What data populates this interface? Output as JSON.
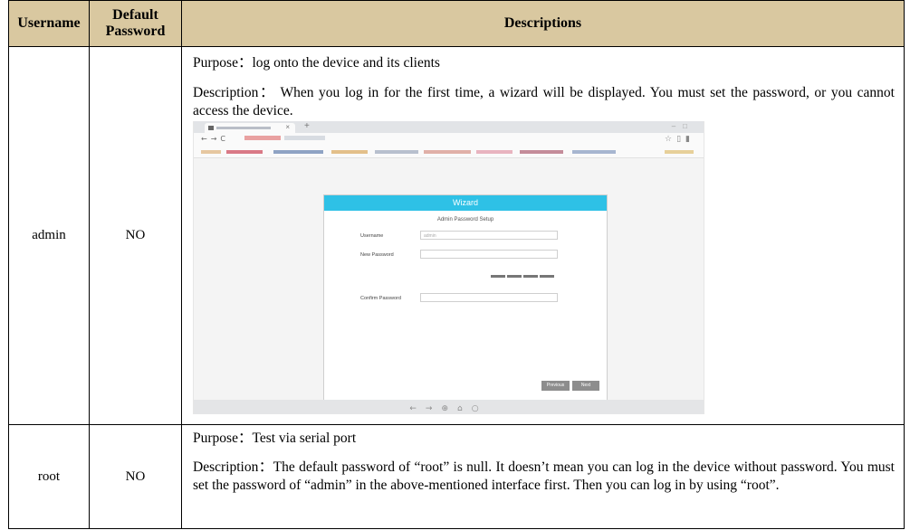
{
  "table": {
    "headers": {
      "username": "Username",
      "default_password": "Default Password",
      "descriptions": "Descriptions"
    },
    "rows": [
      {
        "username": "admin",
        "default_password": "NO",
        "purpose": "Purpose：log onto the device and its clients",
        "description": "Description：  When you log in for the first time, a wizard will be displayed. You must set the password, or you cannot access the device."
      },
      {
        "username": "root",
        "default_password": "NO",
        "purpose": "Purpose：Test via serial port",
        "description": "Description：The default password of “root” is null. It doesn’t mean you can log in the device without password. You must set the password of “admin” in the above-mentioned interface first. Then you can log in by using “root”."
      }
    ]
  },
  "wizard": {
    "title": "Wizard",
    "subtitle": "Admin Password Setup",
    "username_label": "Username",
    "username_value": "admin",
    "new_password_label": "New Password",
    "confirm_password_label": "Confirm Password",
    "previous_label": "Previous",
    "next_label": "Next"
  },
  "icons": {
    "browser_nav": "back-forward-reload-icons",
    "bottom_bar": "bottom-toolbar-icons"
  },
  "colors": {
    "header_bg": "#d9c8a0",
    "wizard_accent": "#2ec1e6"
  }
}
